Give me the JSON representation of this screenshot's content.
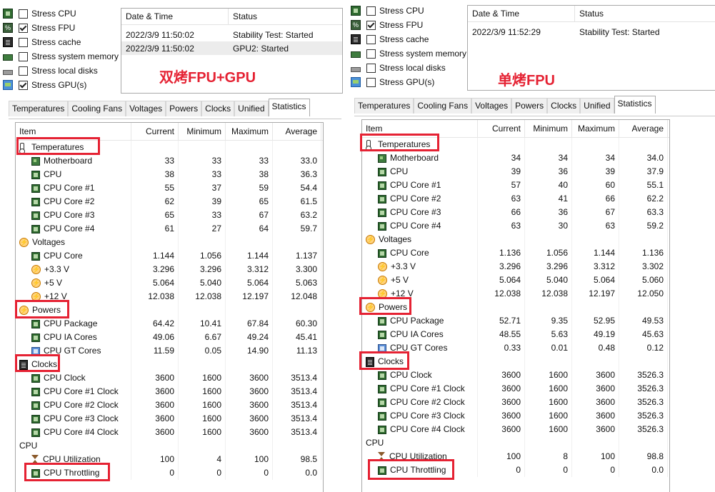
{
  "left": {
    "options": [
      {
        "label": "Stress CPU",
        "checked": false,
        "icon": "cpu-chip-icon"
      },
      {
        "label": "Stress FPU",
        "checked": true,
        "icon": "fpu-icon"
      },
      {
        "label": "Stress cache",
        "checked": false,
        "icon": "cache-icon"
      },
      {
        "label": "Stress system memory",
        "checked": false,
        "icon": "memory-icon"
      },
      {
        "label": "Stress local disks",
        "checked": false,
        "icon": "disk-icon"
      },
      {
        "label": "Stress GPU(s)",
        "checked": true,
        "icon": "monitor-icon"
      }
    ],
    "log": {
      "headers": [
        "Date & Time",
        "Status"
      ],
      "rows": [
        {
          "time": "2022/3/9 11:50:02",
          "status": "Stability Test: Started"
        },
        {
          "time": "2022/3/9 11:50:02",
          "status": "GPU2: Started"
        }
      ]
    },
    "overlay": "双烤FPU+GPU",
    "tabs": [
      "Temperatures",
      "Cooling Fans",
      "Voltages",
      "Powers",
      "Clocks",
      "Unified",
      "Statistics"
    ],
    "active_tab": "Statistics",
    "columns": [
      "Item",
      "Current",
      "Minimum",
      "Maximum",
      "Average"
    ],
    "rows": [
      {
        "type": "cat",
        "icon": "thermometer-icon",
        "label": "Temperatures"
      },
      {
        "icon": "motherboard-icon",
        "label": "Motherboard",
        "v": [
          "33",
          "33",
          "33",
          "33.0"
        ]
      },
      {
        "icon": "cpu-chip-icon",
        "label": "CPU",
        "v": [
          "38",
          "33",
          "38",
          "36.3"
        ]
      },
      {
        "icon": "cpu-chip-icon",
        "label": "CPU Core #1",
        "v": [
          "55",
          "37",
          "59",
          "54.4"
        ]
      },
      {
        "icon": "cpu-chip-icon",
        "label": "CPU Core #2",
        "v": [
          "62",
          "39",
          "65",
          "61.5"
        ]
      },
      {
        "icon": "cpu-chip-icon",
        "label": "CPU Core #3",
        "v": [
          "65",
          "33",
          "67",
          "63.2"
        ]
      },
      {
        "icon": "cpu-chip-icon",
        "label": "CPU Core #4",
        "v": [
          "61",
          "27",
          "64",
          "59.7"
        ]
      },
      {
        "type": "cat",
        "icon": "voltage-icon",
        "label": "Voltages"
      },
      {
        "icon": "cpu-chip-icon",
        "label": "CPU Core",
        "v": [
          "1.144",
          "1.056",
          "1.144",
          "1.137"
        ]
      },
      {
        "icon": "voltage-icon",
        "label": "+3.3 V",
        "v": [
          "3.296",
          "3.296",
          "3.312",
          "3.300"
        ]
      },
      {
        "icon": "voltage-icon",
        "label": "+5 V",
        "v": [
          "5.064",
          "5.040",
          "5.064",
          "5.063"
        ]
      },
      {
        "icon": "voltage-icon",
        "label": "+12 V",
        "v": [
          "12.038",
          "12.038",
          "12.197",
          "12.048"
        ]
      },
      {
        "type": "cat",
        "icon": "power-icon",
        "label": "Powers"
      },
      {
        "icon": "cpu-chip-icon",
        "label": "CPU Package",
        "v": [
          "64.42",
          "10.41",
          "67.84",
          "60.30"
        ]
      },
      {
        "icon": "cpu-chip-icon",
        "label": "CPU IA Cores",
        "v": [
          "49.06",
          "6.67",
          "49.24",
          "45.41"
        ]
      },
      {
        "icon": "gpu-chip-icon",
        "label": "CPU GT Cores",
        "v": [
          "11.59",
          "0.05",
          "14.90",
          "11.13"
        ]
      },
      {
        "type": "cat",
        "icon": "clock-chip-icon",
        "label": "Clocks"
      },
      {
        "icon": "cpu-chip-icon",
        "label": "CPU Clock",
        "v": [
          "3600",
          "1600",
          "3600",
          "3513.4"
        ]
      },
      {
        "icon": "cpu-chip-icon",
        "label": "CPU Core #1 Clock",
        "v": [
          "3600",
          "1600",
          "3600",
          "3513.4"
        ]
      },
      {
        "icon": "cpu-chip-icon",
        "label": "CPU Core #2 Clock",
        "v": [
          "3600",
          "1600",
          "3600",
          "3513.4"
        ]
      },
      {
        "icon": "cpu-chip-icon",
        "label": "CPU Core #3 Clock",
        "v": [
          "3600",
          "1600",
          "3600",
          "3513.4"
        ]
      },
      {
        "icon": "cpu-chip-icon",
        "label": "CPU Core #4 Clock",
        "v": [
          "3600",
          "1600",
          "3600",
          "3513.4"
        ]
      },
      {
        "type": "cat",
        "icon": "",
        "label": "CPU"
      },
      {
        "icon": "hourglass-icon",
        "label": "CPU Utilization",
        "v": [
          "100",
          "4",
          "100",
          "98.5"
        ]
      },
      {
        "icon": "cpu-chip-icon",
        "label": "CPU Throttling",
        "v": [
          "0",
          "0",
          "0",
          "0.0"
        ]
      }
    ]
  },
  "right": {
    "options": [
      {
        "label": "Stress CPU",
        "checked": false,
        "icon": "cpu-chip-icon"
      },
      {
        "label": "Stress FPU",
        "checked": true,
        "icon": "fpu-icon"
      },
      {
        "label": "Stress cache",
        "checked": false,
        "icon": "cache-icon"
      },
      {
        "label": "Stress system memory",
        "checked": false,
        "icon": "memory-icon"
      },
      {
        "label": "Stress local disks",
        "checked": false,
        "icon": "disk-icon"
      },
      {
        "label": "Stress GPU(s)",
        "checked": false,
        "icon": "monitor-icon"
      }
    ],
    "log": {
      "headers": [
        "Date & Time",
        "Status"
      ],
      "rows": [
        {
          "time": "2022/3/9 11:52:29",
          "status": "Stability Test: Started"
        }
      ]
    },
    "overlay": "单烤FPU",
    "tabs": [
      "Temperatures",
      "Cooling Fans",
      "Voltages",
      "Powers",
      "Clocks",
      "Unified",
      "Statistics"
    ],
    "active_tab": "Statistics",
    "columns": [
      "Item",
      "Current",
      "Minimum",
      "Maximum",
      "Average"
    ],
    "rows": [
      {
        "type": "cat",
        "icon": "thermometer-icon",
        "label": "Temperatures"
      },
      {
        "icon": "motherboard-icon",
        "label": "Motherboard",
        "v": [
          "34",
          "34",
          "34",
          "34.0"
        ]
      },
      {
        "icon": "cpu-chip-icon",
        "label": "CPU",
        "v": [
          "39",
          "36",
          "39",
          "37.9"
        ]
      },
      {
        "icon": "cpu-chip-icon",
        "label": "CPU Core #1",
        "v": [
          "57",
          "40",
          "60",
          "55.1"
        ]
      },
      {
        "icon": "cpu-chip-icon",
        "label": "CPU Core #2",
        "v": [
          "63",
          "41",
          "66",
          "62.2"
        ]
      },
      {
        "icon": "cpu-chip-icon",
        "label": "CPU Core #3",
        "v": [
          "66",
          "36",
          "67",
          "63.3"
        ]
      },
      {
        "icon": "cpu-chip-icon",
        "label": "CPU Core #4",
        "v": [
          "63",
          "30",
          "63",
          "59.2"
        ]
      },
      {
        "type": "cat",
        "icon": "voltage-icon",
        "label": "Voltages"
      },
      {
        "icon": "cpu-chip-icon",
        "label": "CPU Core",
        "v": [
          "1.136",
          "1.056",
          "1.144",
          "1.136"
        ]
      },
      {
        "icon": "voltage-icon",
        "label": "+3.3 V",
        "v": [
          "3.296",
          "3.296",
          "3.312",
          "3.302"
        ]
      },
      {
        "icon": "voltage-icon",
        "label": "+5 V",
        "v": [
          "5.064",
          "5.040",
          "5.064",
          "5.060"
        ]
      },
      {
        "icon": "voltage-icon",
        "label": "+12 V",
        "v": [
          "12.038",
          "12.038",
          "12.197",
          "12.050"
        ]
      },
      {
        "type": "cat",
        "icon": "power-icon",
        "label": "Powers"
      },
      {
        "icon": "cpu-chip-icon",
        "label": "CPU Package",
        "v": [
          "52.71",
          "9.35",
          "52.95",
          "49.53"
        ]
      },
      {
        "icon": "cpu-chip-icon",
        "label": "CPU IA Cores",
        "v": [
          "48.55",
          "5.63",
          "49.19",
          "45.63"
        ]
      },
      {
        "icon": "gpu-chip-icon",
        "label": "CPU GT Cores",
        "v": [
          "0.33",
          "0.01",
          "0.48",
          "0.12"
        ]
      },
      {
        "type": "cat",
        "icon": "clock-chip-icon",
        "label": "Clocks"
      },
      {
        "icon": "cpu-chip-icon",
        "label": "CPU Clock",
        "v": [
          "3600",
          "1600",
          "3600",
          "3526.3"
        ]
      },
      {
        "icon": "cpu-chip-icon",
        "label": "CPU Core #1 Clock",
        "v": [
          "3600",
          "1600",
          "3600",
          "3526.3"
        ]
      },
      {
        "icon": "cpu-chip-icon",
        "label": "CPU Core #2 Clock",
        "v": [
          "3600",
          "1600",
          "3600",
          "3526.3"
        ]
      },
      {
        "icon": "cpu-chip-icon",
        "label": "CPU Core #3 Clock",
        "v": [
          "3600",
          "1600",
          "3600",
          "3526.3"
        ]
      },
      {
        "icon": "cpu-chip-icon",
        "label": "CPU Core #4 Clock",
        "v": [
          "3600",
          "1600",
          "3600",
          "3526.3"
        ]
      },
      {
        "type": "cat",
        "icon": "",
        "label": "CPU"
      },
      {
        "icon": "hourglass-icon",
        "label": "CPU Utilization",
        "v": [
          "100",
          "8",
          "100",
          "98.8"
        ]
      },
      {
        "icon": "cpu-chip-icon",
        "label": "CPU Throttling",
        "v": [
          "0",
          "0",
          "0",
          "0.0"
        ]
      }
    ]
  },
  "colors": {
    "highlight": "#e52233",
    "overlay_text": "#e52233",
    "selected_row": "#ececec"
  }
}
